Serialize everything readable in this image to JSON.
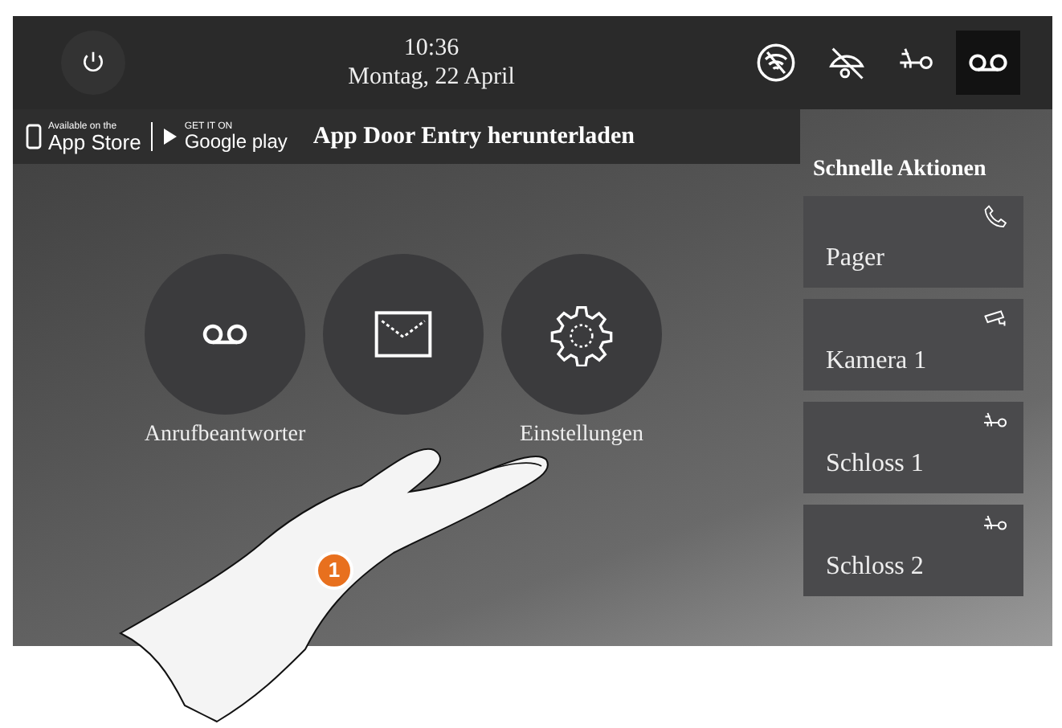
{
  "header": {
    "time": "10:36",
    "date": "Montag, 22 April"
  },
  "status_icons": [
    {
      "kind": "wifi-off",
      "selected": false
    },
    {
      "kind": "visibility-off",
      "selected": false
    },
    {
      "kind": "key",
      "selected": false
    },
    {
      "kind": "voicemail",
      "selected": true
    }
  ],
  "app_banner": {
    "appstore_small": "Available on the",
    "appstore": "App Store",
    "play_small": "GET IT ON",
    "play": "Google play",
    "text": "App Door Entry herunterladen"
  },
  "tiles": [
    {
      "kind": "voicemail",
      "label": "Anrufbeantworter"
    },
    {
      "kind": "envelope"
    },
    {
      "kind": "gear",
      "label": "Einstellungen"
    }
  ],
  "quick_actions": {
    "title": "Schnelle Aktionen",
    "items": [
      {
        "kind": "phone",
        "label": "Pager"
      },
      {
        "kind": "camera",
        "label": "Kamera 1"
      },
      {
        "kind": "key",
        "label": "Schloss 1"
      },
      {
        "kind": "key",
        "label": "Schloss 2"
      }
    ]
  },
  "callout": "1"
}
